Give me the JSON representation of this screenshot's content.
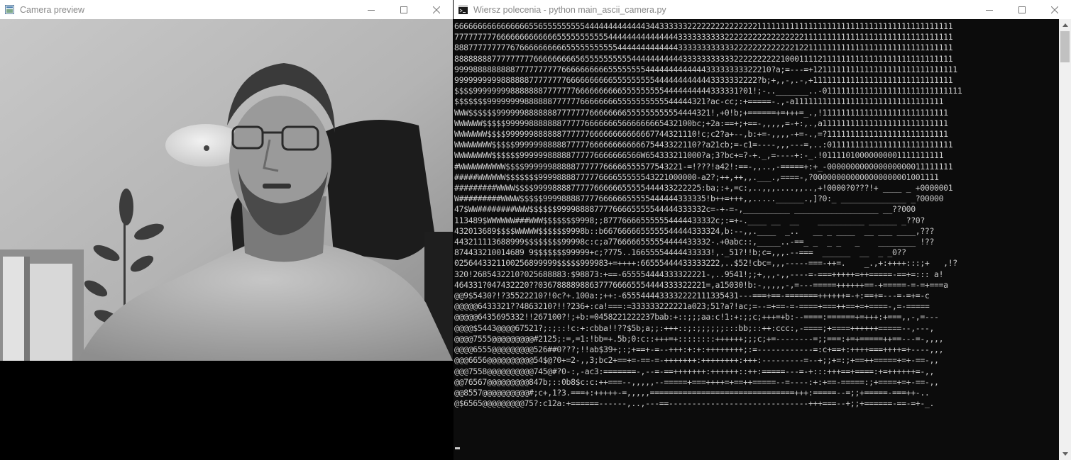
{
  "camera_window": {
    "title": "Camera preview"
  },
  "console_window": {
    "title": "Wiersz polecenia - python  main_ascii_camera.py",
    "lines": [
      "66666666666666665565555555554444444444444344333333222222222222222111111111111111111111111111111111111111111",
      "77777777766666666666665555555555544444444444444433333333332222222222222222211111111111111111111111111111111",
      "88877777777767666666666655555555555444444444444433333333333322222222222221221111111111111111111111111111111",
      "88888888777777777666666666565555555555444444444443333333333322222222221000111121111111111111111111111111111",
      "99998888888887777777777666666666655555555444444444444433333333322210?a;=---=+1211111111111111111111111111111",
      "99999999998888887777777766666666665555555554444444444443333332222?b;+,,-,.-,+111111111111111111111111111111",
      "$$$$999999998888888777777766666666665555555554444444444333331?01!;-.._______..-011111111111111111111111111111",
      "$$$$$$$99999999888888777777666666665555555555544444321?ac-cc;:+=====-.,-a11111111111111111111111111111111",
      "WWW$$$$$$9999998888888777777766666666555555555554444321!,+0!b;+======+=+++=_.,!111111111111111111111111111",
      "WWWWWW$$$$$9999988888887777766666665666666665432100bc;+2a:==+;+==-,,,,,=-+:,.,a111111111111111111111111111",
      "WWWWWWW$$$$99999988888877777766666666666667744321110!c;c2?a+--,b:+=-,,,,-+=-.,=?11111111111111111111111111",
      "WWWWWWWW$$$$$999999888887777766666666666675443322110??a21cb;=-c1=----,,,---=,..:011111111111111111111111111",
      "WWWWWWWW$$$$$$99999988888777776666666566W654333211000?a;3?bc+=?-+._,=----+:-_.!01111010000000001111111111",
      "#WWWWWWWWWW$$$$9999998888877777766666555577543221-=!???!a42!:==-,,..,-=====+:+_-000000000000000000011111111",
      "#####WWWWWW$$$$$$$9999888877777666655555543221000000-a2?;++,++,,.___.,====-,?000000000000000000001001111",
      "#########WWWW$$$$999988887777766666655555444433222225:ba;:+,=c:,..,,,....,,..,+!0000?0???!+ ____ _ +0000001",
      "W#########WWWW$$$$$99998888777766666655555444444333335!b++=+++,,.....______.,]?0:_ ______________ _?00000",
      "47$WW########WWW$$$$$$99998888777766665555544444333332c=-+-=-,__________ __________________ __??000",
      "113489$WWWWWW###WWW$$$$$$$9998;;877766665555554444433332c;:=+-.____ __  __    __________ ______ _??0?",
      "432013689$$$$WWWWW$$$$$$9998b::b6676666655555544444333324,b:--,,.____  _..   __ _ ____  __ ___ ____,???",
      "443211113688999$$$$$$$$99998c:c;a7766666555554444433332-.+0abc::,_____..-==_ _  _ _   _    ________ !??",
      "874433210014689 9$$$$$$$99999+c;?775..16655554444433333!,._51?!!b;c=,,,.--===  ______  __  _ _0??",
      "0256443321100256899999$$$$$999983+=++++:66555444433333222,..$52!cbc=,,,-----===-++=.    _.,+:++++:::;+   ,!?",
      "320!2685432210?025688883:$98873:+==-655554444333322221-,..9541!;;+,,,-,,----=-===+++++=++=====-==+=::: a!",
      "464331?047432220??036788889886377766665554444333322221=,a15030!b:-,,,,,-,=---=====++++++==-+=====-=-=+===a",
      "@@9$5430?!?35522210?!0c?+.100a:;++:-6555444433332222111335431---===+==-=======++++++=-+:==+=---=-=+=-c",
      "@@@@@6433321??4863210?!!?236+:ca!===:=333333222221a023;51?a?!ac;=--=+==-=-====+===++==+=+====-,=-=====",
      "@@@@@6435695332!!267100?!;+b:=0458221222237bab:+::;;;aa:c!1:+:;;c;+++=+b:--====:======+=+++:+===,,-,=---",
      "@@@@$5443@@@@67521?;:;::!c:+:cbba!!??$5b;a;;:+++::;:;;;;;;:::bb;::++:ccc:,-====;+====++++++=====--,---,",
      "@@@@7555@@@@@@@@@#2125;:=,=1:!bb=+.5b;0:c::+++=+::::::::++++++;;;c;+=--------=;;===:+=+=====++==---=-,,,,",
      "@@@@6555@@@@@@@@@526##0???;!!ab$39+;:;+==+-=--+++:+:+:++++++++;:=------------=:c+==+:++++===++++=+----,,,",
      "@@@6656@@@@@@@@@@54$@?0+=2-,,3;bc2+==+=-==-=-+++++++:++++++++:+++:---------=--+;;+=:;+==++=====+=+-==-,,",
      "@@@7558@@@@@@@@@@745@#?0-:,-ac3:=======-,--=-==+++++++:++++++::++:=====---=-+:::+++==+====:+=++++++=-,,",
      "@@76567@@@@@@@@@847b;::0b8$c:c:++===--,,,,,--=====+===++++=+==++=====--=----:+:+==-=====:;+====+=+-==-,,",
      "@@8557@@@@@@@@@@#;c+,1?3.===+:+++++-=,,,,,===============================+++:=====--=;;+=====-===++-..",
      "@$6565@@@@@@@@@75?:c12a:+======------,..,---==------------------------------+++===--+;;+======-==-=+-_."
    ]
  },
  "colors": {
    "console_bg": "#0c0c0c",
    "console_fg": "#cccccc",
    "titlebar_bg": "#ffffff",
    "title_text": "#888888"
  },
  "icons": [
    "camera-window-app-icon",
    "cmd-console-icon",
    "minimize-icon",
    "maximize-icon",
    "close-icon",
    "scroll-up-arrow-icon",
    "scroll-down-arrow-icon"
  ]
}
